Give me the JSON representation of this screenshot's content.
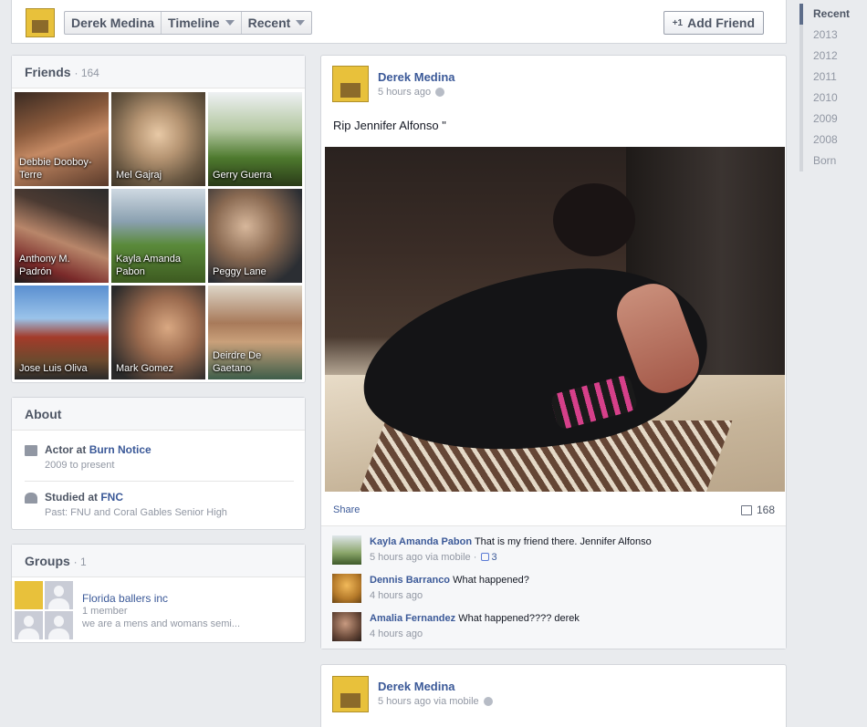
{
  "header": {
    "profile_name": "Derek Medina",
    "timeline_label": "Timeline",
    "recent_label": "Recent",
    "add_friend_label": "Add Friend",
    "add_friend_icon": "+1"
  },
  "year_nav": [
    "Recent",
    "2013",
    "2012",
    "2011",
    "2010",
    "2009",
    "2008",
    "Born"
  ],
  "friends": {
    "title": "Friends",
    "count": "164",
    "items": [
      {
        "name": "Debbie Dooboy-\nTerre"
      },
      {
        "name": "Mel Gajraj"
      },
      {
        "name": "Gerry Guerra"
      },
      {
        "name": "Anthony M.\nPadrón"
      },
      {
        "name": "Kayla Amanda\nPabon"
      },
      {
        "name": "Peggy Lane"
      },
      {
        "name": "Jose Luis Oliva"
      },
      {
        "name": "Mark Gomez"
      },
      {
        "name": "Deirdre De\nGaetano"
      }
    ]
  },
  "about": {
    "title": "About",
    "work_prefix": "Actor at ",
    "work_place": "Burn Notice",
    "work_years": "2009 to present",
    "edu_prefix": "Studied at ",
    "edu_place": "FNC",
    "edu_past": "Past: FNU and Coral Gables Senior High"
  },
  "groups": {
    "title": "Groups",
    "count": "1",
    "name": "Florida ballers inc",
    "members": "1 member",
    "description": "we are a mens and womans semi..."
  },
  "post1": {
    "author": "Derek Medina",
    "time": "5 hours ago",
    "text": "Rip Jennifer Alfonso \"",
    "share_label": "Share",
    "comment_count": "168",
    "comments": [
      {
        "name": "Kayla Amanda Pabon",
        "text": "That is my friend there. Jennifer Alfonso",
        "meta": "5 hours ago via mobile ·",
        "likes": "3"
      },
      {
        "name": "Dennis Barranco",
        "text": "What happened?",
        "meta": "4 hours ago"
      },
      {
        "name": "Amalia Fernandez",
        "text": "What happened???? derek",
        "meta": "4 hours ago"
      }
    ]
  },
  "post2": {
    "author": "Derek Medina",
    "time": "5 hours ago via mobile"
  },
  "colors": {
    "link": "#3b5998",
    "background": "#e9ebee",
    "muted": "#9197a3"
  }
}
